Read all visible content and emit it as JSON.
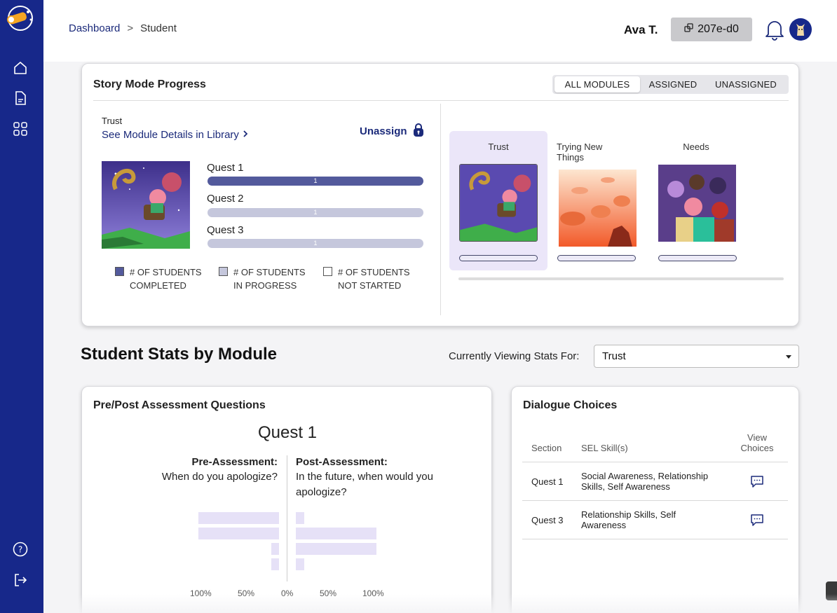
{
  "colors": {
    "sidebar": "#17288a",
    "completed": "#535a9c",
    "in_progress": "#c5c7dc",
    "accent_link": "#1b2a7a",
    "selected_tile": "#ebe6f9"
  },
  "sidebar": {
    "logo": "telescope-logo",
    "items": [
      {
        "icon": "home-icon"
      },
      {
        "icon": "document-icon"
      },
      {
        "icon": "grid-icon"
      }
    ],
    "bottom": [
      {
        "icon": "help-icon"
      },
      {
        "icon": "logout-icon"
      }
    ]
  },
  "header": {
    "breadcrumb": {
      "root": "Dashboard",
      "sep": ">",
      "current": "Student"
    },
    "user_name": "Ava T.",
    "class_code": "207e-d0"
  },
  "story": {
    "title": "Story Mode Progress",
    "filters": [
      "ALL MODULES",
      "ASSIGNED",
      "UNASSIGNED"
    ],
    "active_filter": "ALL MODULES",
    "module_name": "Trust",
    "library_link": "See Module Details in Library",
    "unassign_label": "Unassign",
    "quests": [
      {
        "label": "Quest 1",
        "count": "1",
        "status": "completed"
      },
      {
        "label": "Quest 2",
        "count": "1",
        "status": "in_progress"
      },
      {
        "label": "Quest 3",
        "count": "1",
        "status": "in_progress"
      }
    ],
    "legend": [
      {
        "line1": "# OF STUDENTS",
        "line2": "COMPLETED"
      },
      {
        "line1": "# OF STUDENTS",
        "line2": "IN PROGRESS"
      },
      {
        "line1": "# OF STUDENTS",
        "line2": "NOT STARTED"
      }
    ],
    "modules": [
      {
        "title": "Trust",
        "selected": true
      },
      {
        "title": "Trying New Things",
        "selected": false
      },
      {
        "title": "Needs",
        "selected": false
      }
    ]
  },
  "stats": {
    "title": "Student Stats by Module",
    "viewing_label": "Currently Viewing Stats For:",
    "selected_module": "Trust"
  },
  "assessment": {
    "title": "Pre/Post Assessment Questions",
    "quest": "Quest 1",
    "pre_heading": "Pre-Assessment:",
    "pre_question": "When do you apologize?",
    "post_heading": "Post-Assessment:",
    "post_question_line1": "In the future, when would you",
    "post_question_line2": "apologize?",
    "pre_values": [
      100,
      100,
      10,
      10
    ],
    "post_values": [
      10,
      100,
      100,
      10
    ],
    "ticks": [
      "100%",
      "50%",
      "0%",
      "50%",
      "100%"
    ]
  },
  "dialogue": {
    "title": "Dialogue Choices",
    "headers": {
      "section": "Section",
      "skills": "SEL Skill(s)",
      "view_line1": "View",
      "view_line2": "Choices"
    },
    "rows": [
      {
        "section": "Quest 1",
        "skills_line1": "Social Awareness, Relationship",
        "skills_line2": "Skills, Self Awareness"
      },
      {
        "section": "Quest 3",
        "skills_line1": "Relationship Skills, Self",
        "skills_line2": "Awareness"
      }
    ]
  }
}
